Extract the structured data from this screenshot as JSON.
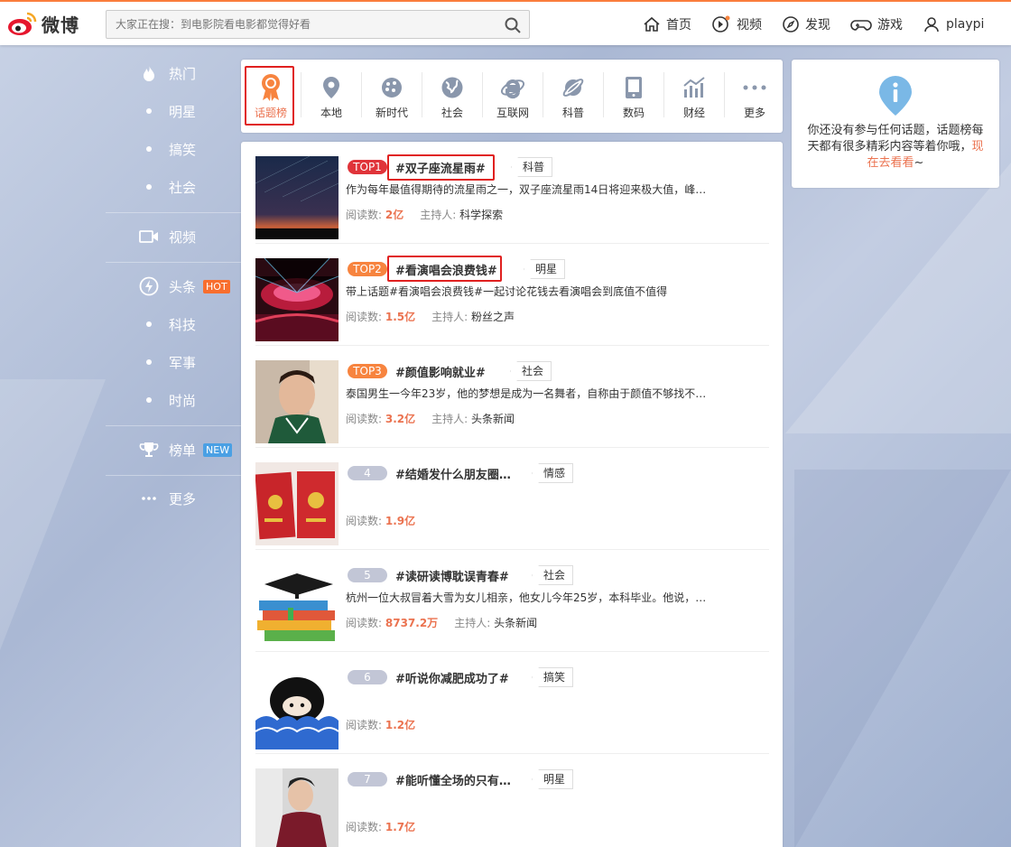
{
  "header": {
    "logo_text": "微博",
    "search_placeholder": "大家正在搜：到电影院看电影都觉得好看",
    "nav": [
      {
        "label": "首页",
        "icon": "home-icon"
      },
      {
        "label": "视频",
        "icon": "video-icon"
      },
      {
        "label": "发现",
        "icon": "compass-icon"
      },
      {
        "label": "游戏",
        "icon": "gamepad-icon"
      },
      {
        "label": "playpi",
        "icon": "user-icon"
      }
    ]
  },
  "leftmenu": {
    "hot": "热门",
    "hot_subs": [
      "明星",
      "搞笑",
      "社会"
    ],
    "video": "视频",
    "headline": "头条",
    "headline_badge": "HOT",
    "headline_subs": [
      "科技",
      "军事",
      "时尚"
    ],
    "ranking": "榜单",
    "ranking_badge": "NEW",
    "more": "更多"
  },
  "categories": [
    "话题榜",
    "本地",
    "新时代",
    "社会",
    "互联网",
    "科普",
    "数码",
    "财经",
    "更多"
  ],
  "topics": [
    {
      "rank": "TOP1",
      "title": "#双子座流星雨#",
      "tag": "科普",
      "desc": "作为每年最值得期待的流星雨之一，双子座流星雨14日将迎来极大值，峰…",
      "reads_label": "阅读数:",
      "reads": "2亿",
      "host_label": "主持人:",
      "host": "科学探索"
    },
    {
      "rank": "TOP2",
      "title": "#看演唱会浪费钱#",
      "tag": "明星",
      "desc": "带上话题#看演唱会浪费钱#一起讨论花钱去看演唱会到底值不值得",
      "reads_label": "阅读数:",
      "reads": "1.5亿",
      "host_label": "主持人:",
      "host": "粉丝之声"
    },
    {
      "rank": "TOP3",
      "title": "#颜值影响就业#",
      "tag": "社会",
      "desc": "泰国男生一今年23岁，他的梦想是成为一名舞者，自称由于颜值不够找不…",
      "reads_label": "阅读数:",
      "reads": "3.2亿",
      "host_label": "主持人:",
      "host": "头条新闻"
    },
    {
      "rank": "4",
      "title": "#结婚发什么朋友圈…",
      "tag": "情感",
      "desc": "",
      "reads_label": "阅读数:",
      "reads": "1.9亿",
      "host_label": "",
      "host": ""
    },
    {
      "rank": "5",
      "title": "#读研读博耽误青春#",
      "tag": "社会",
      "desc": "杭州一位大叔冒着大雪为女儿相亲，他女儿今年25岁，本科毕业。他说，…",
      "reads_label": "阅读数:",
      "reads": "8737.2万",
      "host_label": "主持人:",
      "host": "头条新闻"
    },
    {
      "rank": "6",
      "title": "#听说你减肥成功了#",
      "tag": "搞笑",
      "desc": "",
      "reads_label": "阅读数:",
      "reads": "1.2亿",
      "host_label": "",
      "host": ""
    },
    {
      "rank": "7",
      "title": "#能听懂全场的只有…",
      "tag": "明星",
      "desc": "",
      "reads_label": "阅读数:",
      "reads": "1.7亿",
      "host_label": "",
      "host": ""
    }
  ],
  "rightcard": {
    "text": "你还没有参与任何话题，话题榜每天都有很多精彩内容等着你哦，",
    "link": "现在去看看",
    "suffix": "~"
  },
  "colors": {
    "accent": "#eb7350",
    "top1": "#e0343a",
    "top23": "#f7843f",
    "rank_gray": "#c2c6d6",
    "highlight_box": "#e0201f"
  }
}
